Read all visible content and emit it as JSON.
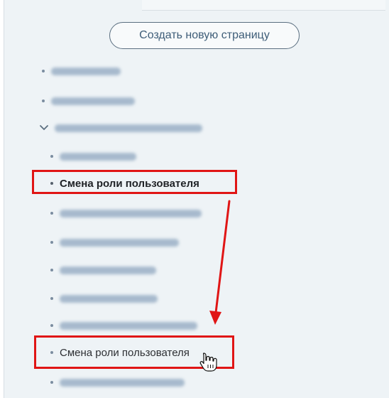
{
  "create_button_label": "Создать новую страницу",
  "tree": {
    "active_item_label": "Смена роли пользователя",
    "moved_item_label": "Смена роли пользователя"
  },
  "colors": {
    "highlight": "#e01515",
    "panel_bg": "#eef3f6",
    "button_border": "#5b6f80"
  },
  "icons": [
    "chevron-down-icon",
    "hand-cursor-icon",
    "arrow-icon"
  ]
}
